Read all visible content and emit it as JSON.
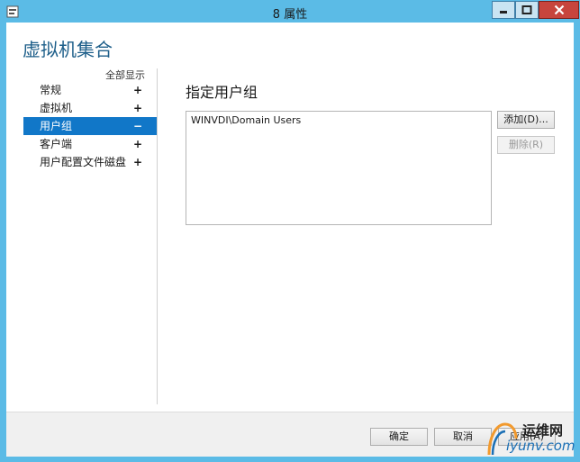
{
  "window": {
    "title": "8 属性"
  },
  "page": {
    "heading": "虚拟机集合",
    "show_all": "全部显示"
  },
  "nav": {
    "items": [
      {
        "label": "常规",
        "sign": "+"
      },
      {
        "label": "虚拟机",
        "sign": "+"
      },
      {
        "label": "用户组",
        "sign": "−",
        "selected": true
      },
      {
        "label": "客户端",
        "sign": "+"
      },
      {
        "label": "用户配置文件磁盘",
        "sign": "+"
      }
    ]
  },
  "section": {
    "title": "指定用户组",
    "list": [
      "WINVDI\\Domain Users"
    ],
    "add_label": "添加(D)...",
    "delete_label": "删除(R)"
  },
  "footer": {
    "ok_label": "确定",
    "cancel_label": "取消",
    "apply_label": "应用(A)"
  },
  "watermark": {
    "line1": "运维网",
    "line2": "iyunv.com"
  },
  "colors": {
    "titlebar": "#5bbbe6",
    "selected": "#1177c8",
    "heading": "#1e5f8a",
    "close": "#c7453d"
  }
}
